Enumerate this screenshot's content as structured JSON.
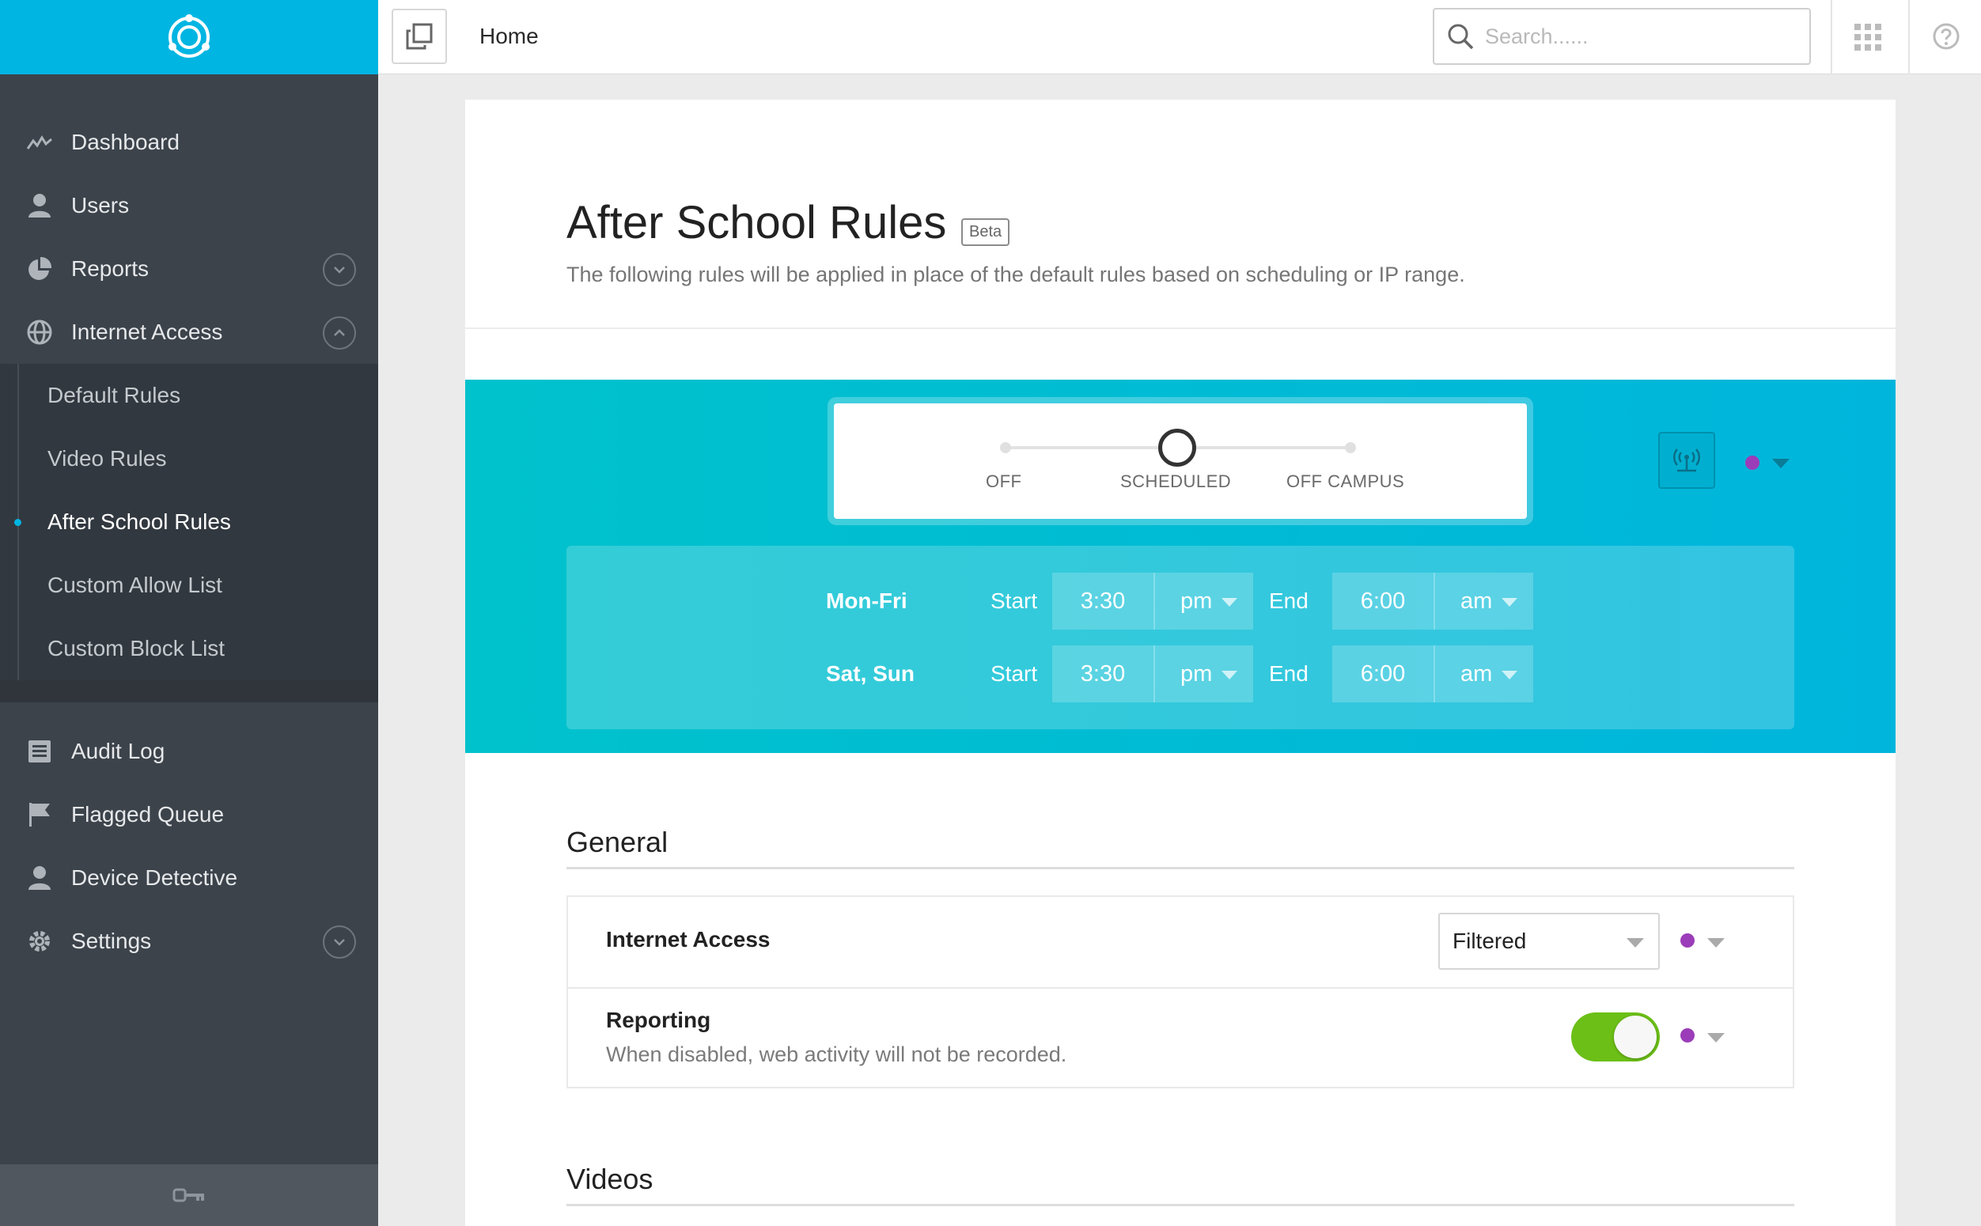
{
  "sidebar": {
    "nav_items": [
      {
        "label": "Dashboard",
        "icon": "activity-icon"
      },
      {
        "label": "Users",
        "icon": "user-icon"
      },
      {
        "label": "Reports",
        "icon": "pie-chart-icon"
      },
      {
        "label": "Internet Access",
        "icon": "globe-icon"
      }
    ],
    "sub_items": [
      {
        "label": "Default Rules"
      },
      {
        "label": "Video Rules"
      },
      {
        "label": "After School Rules"
      },
      {
        "label": "Custom Allow List"
      },
      {
        "label": "Custom Block List"
      }
    ],
    "nav_items2": [
      {
        "label": "Audit Log",
        "icon": "list-icon"
      },
      {
        "label": "Flagged Queue",
        "icon": "flag-icon"
      },
      {
        "label": "Device Detective",
        "icon": "user-icon"
      },
      {
        "label": "Settings",
        "icon": "gear-icon"
      }
    ]
  },
  "topbar": {
    "breadcrumb": "Home",
    "search_placeholder": "Search......"
  },
  "page": {
    "title": "After School Rules",
    "badge": "Beta",
    "description": "The following rules will be applied in place of the default rules based on scheduling or IP range."
  },
  "mode": {
    "options": [
      "OFF",
      "SCHEDULED",
      "OFF CAMPUS"
    ],
    "selected": "SCHEDULED"
  },
  "schedule": [
    {
      "days": "Mon-Fri",
      "start_label": "Start",
      "start_time": "3:30",
      "start_ampm": "pm",
      "end_label": "End",
      "end_time": "6:00",
      "end_ampm": "am"
    },
    {
      "days": "Sat, Sun",
      "start_label": "Start",
      "start_time": "3:30",
      "start_ampm": "pm",
      "end_label": "End",
      "end_time": "6:00",
      "end_ampm": "am"
    }
  ],
  "general": {
    "title": "General",
    "internet_access": {
      "label": "Internet Access",
      "value": "Filtered"
    },
    "reporting": {
      "label": "Reporting",
      "description": "When disabled, web activity will not be recorded.",
      "enabled": true
    }
  },
  "videos": {
    "title": "Videos"
  },
  "colors": {
    "brand": "#00b5e2",
    "sidebar": "#3c434b",
    "toggle_on": "#6bbf16",
    "policy_dot": "#9b3db8"
  }
}
